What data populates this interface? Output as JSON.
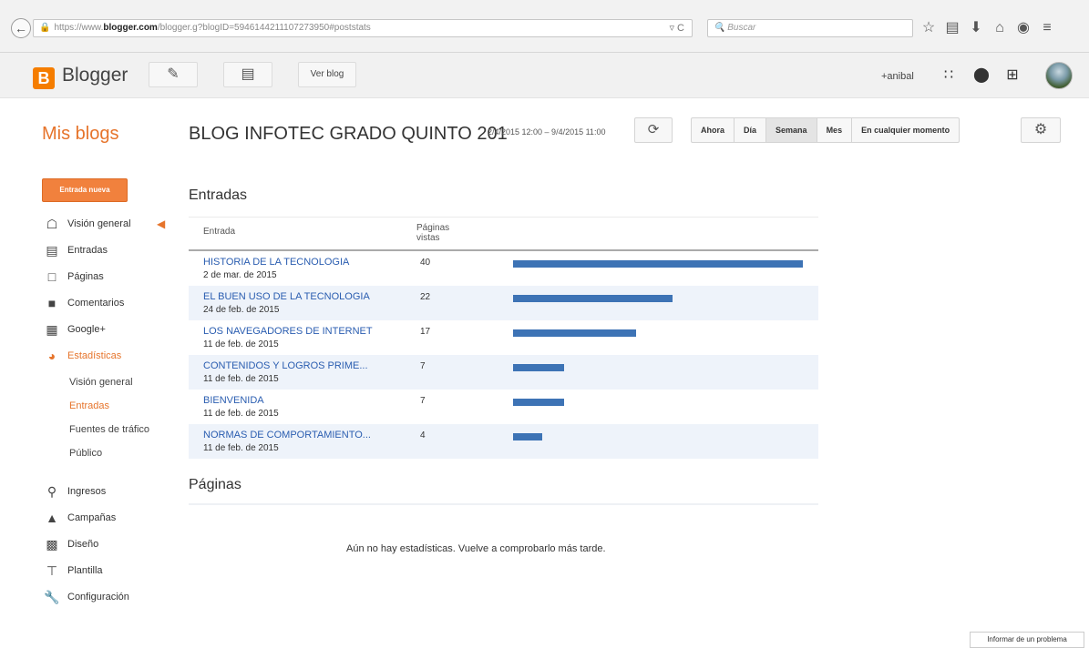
{
  "browser": {
    "url_prefix": "https://www.",
    "url_host": "blogger.com",
    "url_path": "/blogger.g?blogID=5946144211107273950#poststats",
    "url_tools": "▿ C",
    "search_placeholder": "Buscar"
  },
  "header": {
    "brand": "Blogger",
    "view_blog_label": "Ver blog",
    "user": "+anibal"
  },
  "title_row": {
    "my_blogs": "Mis blogs",
    "blog_title": "BLOG INFOTEC GRADO QUINTO 201",
    "date_range": "2/4/2015 12:00 – 9/4/2015 11:00",
    "segments": [
      "Ahora",
      "Día",
      "Semana",
      "Mes",
      "En cualquier momento"
    ],
    "active_segment": "Semana"
  },
  "sidebar": {
    "new_post": "Entrada nueva",
    "items": [
      {
        "label": "Visión general",
        "icon": "home-icon"
      },
      {
        "label": "Entradas",
        "icon": "posts-icon"
      },
      {
        "label": "Páginas",
        "icon": "page-icon"
      },
      {
        "label": "Comentarios",
        "icon": "comment-icon"
      },
      {
        "label": "Google+",
        "icon": "google-plus-icon"
      },
      {
        "label": "Estadísticas",
        "icon": "stats-pie-icon"
      }
    ],
    "stats_sub": [
      "Visión general",
      "Entradas",
      "Fuentes de tráfico",
      "Público"
    ],
    "items2": [
      {
        "label": "Ingresos",
        "icon": "trophy-icon"
      },
      {
        "label": "Campañas",
        "icon": "campaign-icon"
      },
      {
        "label": "Diseño",
        "icon": "layout-icon"
      },
      {
        "label": "Plantilla",
        "icon": "template-icon"
      },
      {
        "label": "Configuración",
        "icon": "wrench-icon"
      }
    ]
  },
  "main": {
    "entries_title": "Entradas",
    "col_entry": "Entrada",
    "col_views": "Páginas vistas",
    "rows": [
      {
        "title": "HISTORIA DE LA TECNOLOGIA",
        "date": "2 de mar. de 2015",
        "views": "40"
      },
      {
        "title": "EL BUEN USO DE LA TECNOLOGIA",
        "date": "24 de feb. de 2015",
        "views": "22"
      },
      {
        "title": "LOS NAVEGADORES DE INTERNET",
        "date": "11 de feb. de 2015",
        "views": "17"
      },
      {
        "title": "CONTENIDOS Y LOGROS PRIME...",
        "date": "11 de feb. de 2015",
        "views": "7"
      },
      {
        "title": "BIENVENIDA",
        "date": "11 de feb. de 2015",
        "views": "7"
      },
      {
        "title": "NORMAS DE COMPORTAMIENTO...",
        "date": "11 de feb. de 2015",
        "views": "4"
      }
    ],
    "pages_title": "Páginas",
    "no_stats": "Aún no hay estadísticas. Vuelve a comprobarlo más tarde."
  },
  "footer": {
    "report": "Informar de un problema"
  }
}
